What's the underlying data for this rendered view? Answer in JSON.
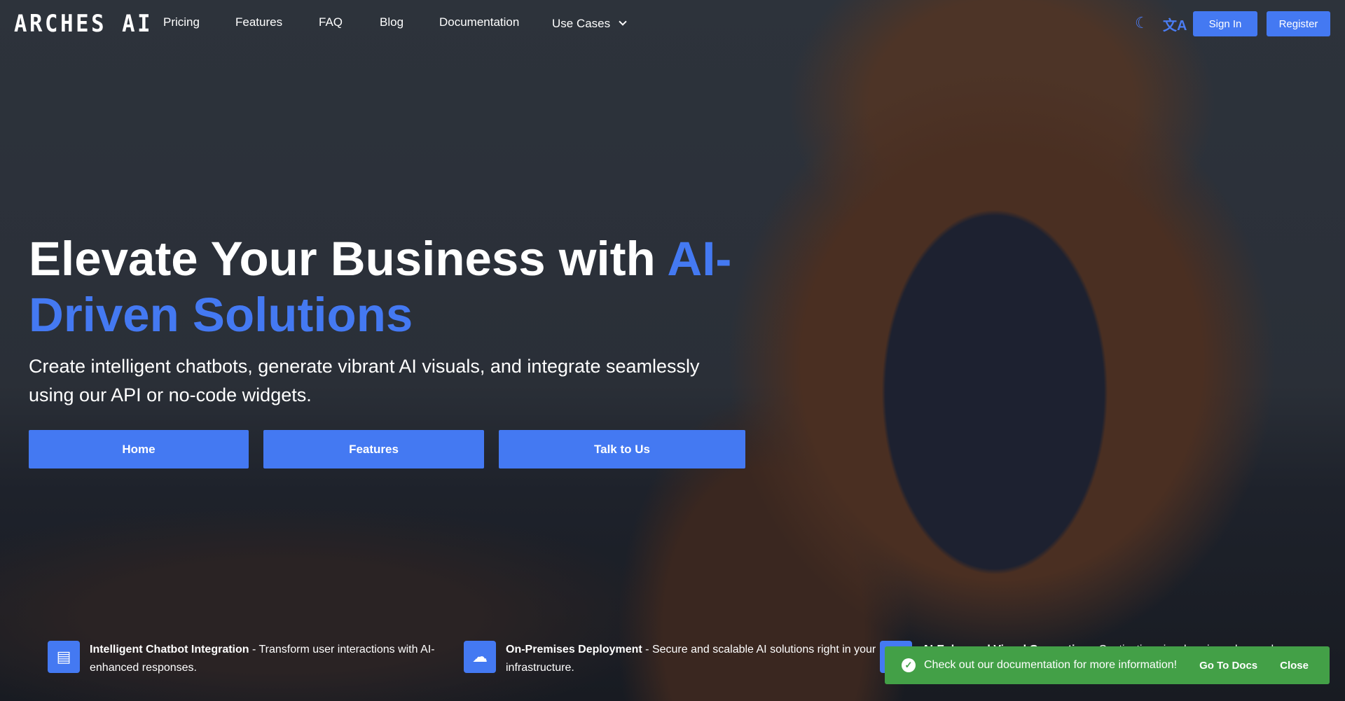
{
  "header": {
    "logo": "ARCHES AI",
    "nav": [
      "Pricing",
      "Features",
      "FAQ",
      "Blog",
      "Documentation"
    ],
    "use_cases": "Use Cases",
    "sign_in": "Sign In",
    "register": "Register",
    "icons": [
      "moon-icon",
      "translate-icon"
    ]
  },
  "hero": {
    "title_white": "Elevate Your Business with ",
    "title_blue": "AI-Driven Solutions",
    "subtitle": "Create intelligent chatbots, generate vibrant AI visuals, and integrate seamlessly using our API or no-code widgets.",
    "buttons": [
      "Home",
      "Features",
      "Talk to Us"
    ]
  },
  "features": [
    {
      "title": "Intelligent Chatbot Integration",
      "desc": " - Transform user interactions with AI-enhanced responses.",
      "icon": "chat-icon"
    },
    {
      "title": "On-Premises Deployment",
      "desc": " - Secure and scalable AI solutions right in your infrastructure.",
      "icon": "cloud-off-icon"
    },
    {
      "title": "AI-Enhanced Visual Generation",
      "desc": " - Captivating visuals using advanced",
      "icon": "image-icon"
    }
  ],
  "toast": {
    "message": "Check out our documentation for more information!",
    "go": "Go To Docs",
    "close": "Close"
  },
  "colors": {
    "accent": "#4479f2",
    "success": "#43a047"
  }
}
